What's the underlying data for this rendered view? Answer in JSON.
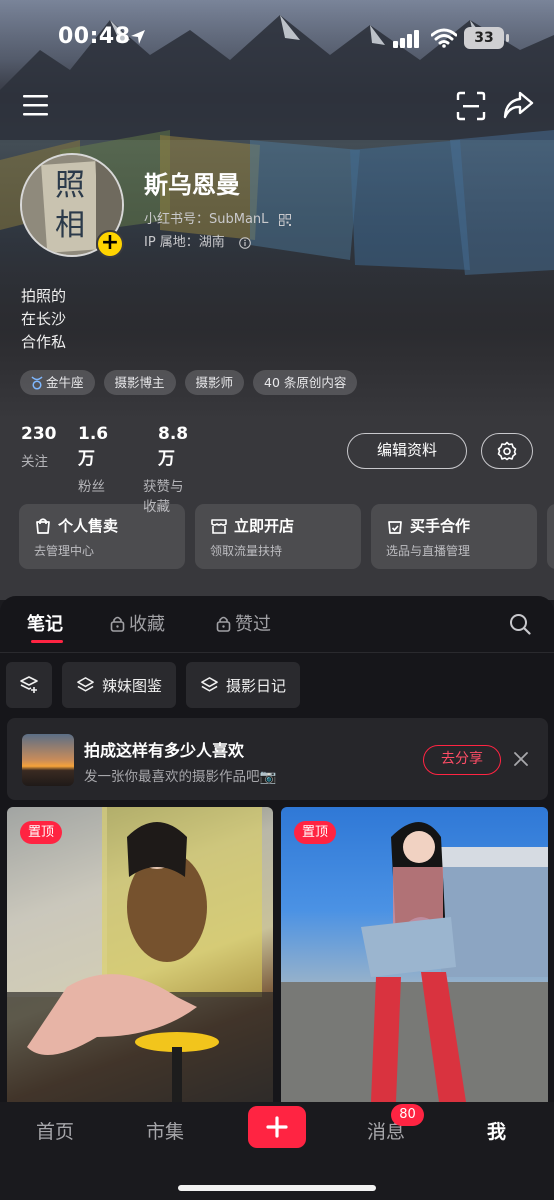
{
  "status_bar": {
    "time": "00:48",
    "battery": "33"
  },
  "profile": {
    "avatar_text": "照相",
    "name": "斯乌恩曼",
    "id_line": "小红书号：SubManL",
    "ip_line": "IP 属地：湖南",
    "bio": [
      "拍照的",
      "在长沙",
      "合作私"
    ],
    "tags": [
      "金牛座",
      "摄影博主",
      "摄影师",
      "40 条原创内容"
    ]
  },
  "stats": [
    {
      "value": "230",
      "label": "关注"
    },
    {
      "value": "1.6万",
      "label": "粉丝"
    },
    {
      "value": "8.8万",
      "label": "获赞与收藏"
    }
  ],
  "actions": {
    "edit_label": "编辑资料"
  },
  "cards": [
    {
      "title": "个人售卖",
      "subtitle": "去管理中心",
      "icon": "bag-icon"
    },
    {
      "title": "立即开店",
      "subtitle": "领取流量扶持",
      "icon": "store-icon"
    },
    {
      "title": "买手合作",
      "subtitle": "选品与直播管理",
      "icon": "handshake-icon"
    }
  ],
  "tabs": [
    {
      "label": "笔记",
      "locked": false,
      "active": true
    },
    {
      "label": "收藏",
      "locked": true,
      "active": false
    },
    {
      "label": "赞过",
      "locked": true,
      "active": false
    }
  ],
  "collections": [
    "辣妹图鉴",
    "摄影日记"
  ],
  "promo": {
    "title": "拍成这样有多少人喜欢",
    "subtitle": "发一张你最喜欢的摄影作品吧📷",
    "button": "去分享"
  },
  "notes": [
    {
      "badge": "置顶"
    },
    {
      "badge": "置顶"
    }
  ],
  "bottom_nav": {
    "home": "首页",
    "market": "市集",
    "messages": "消息",
    "messages_badge": "80",
    "me": "我"
  },
  "colors": {
    "accent": "#ff2442",
    "add_badge": "#ffd400"
  }
}
